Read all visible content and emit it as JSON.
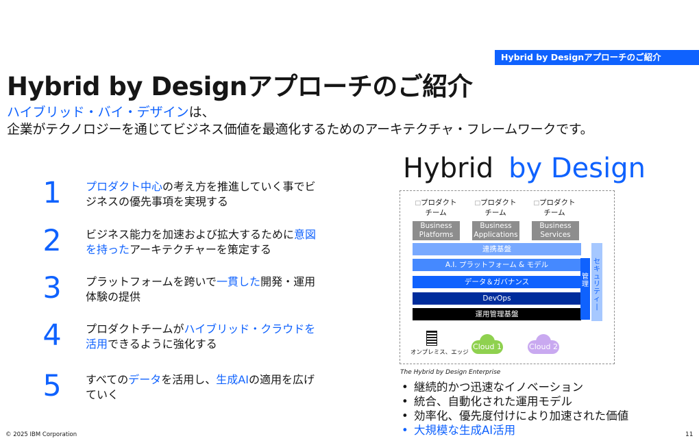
{
  "section_tag": "Hybrid by Designアプローチのご紹介",
  "title": "Hybrid by Designアプローチのご紹介",
  "subtitle": {
    "line1_highlight": "ハイブリッド・バイ・デザイン",
    "line1_rest": "は、",
    "line2": "企業がテクノロジーを通じてビジネス価値を最適化するためのアーキテクチャ・フレームワークです。"
  },
  "items": [
    {
      "number": "1",
      "parts": [
        {
          "text": "プロダクト中心",
          "hl": true
        },
        {
          "text": "の考え方を推進していく事でビジネスの優先事項を実現する",
          "hl": false
        }
      ]
    },
    {
      "number": "2",
      "parts": [
        {
          "text": "ビジネス能力を加速および拡大するために",
          "hl": false
        },
        {
          "text": "意図を持った",
          "hl": true
        },
        {
          "text": "アーキテクチャーを策定する",
          "hl": false
        }
      ]
    },
    {
      "number": "3",
      "parts": [
        {
          "text": "プラットフォームを跨いで",
          "hl": false
        },
        {
          "text": "一貫した",
          "hl": true
        },
        {
          "text": "開発・運用体験の提供",
          "hl": false
        }
      ]
    },
    {
      "number": "4",
      "parts": [
        {
          "text": "プロダクトチームが",
          "hl": false
        },
        {
          "text": "ハイブリッド・クラウドを活用",
          "hl": true
        },
        {
          "text": "できるように強化する",
          "hl": false
        }
      ]
    },
    {
      "number": "5",
      "parts": [
        {
          "text": "すべての",
          "hl": false
        },
        {
          "text": "データ",
          "hl": true
        },
        {
          "text": "を活用し、",
          "hl": false
        },
        {
          "text": "生成AI",
          "hl": true
        },
        {
          "text": "の適用を広げていく",
          "hl": false
        }
      ]
    }
  ],
  "diagram": {
    "heading_black": "Hybrid",
    "heading_blue": "by Design",
    "teams": [
      "プロダクト\nチーム",
      "プロダクト\nチーム",
      "プロダクト\nチーム"
    ],
    "platforms": [
      "Business\nPlatforms",
      "Business\nApplications",
      "Business\nServices"
    ],
    "layers": [
      {
        "label": "連携基盤",
        "color": "#78a9ff"
      },
      {
        "label": "A.I. プラットフォーム & モデル",
        "color": "#4589ff"
      },
      {
        "label": "データ＆ガバナンス",
        "color": "#0f62fe"
      },
      {
        "label": "DevOps",
        "color": "#002d9c"
      },
      {
        "label": "運用管理基盤",
        "color": "#000000"
      }
    ],
    "side_manage": "管理",
    "side_security": "セキュリティー",
    "onprem_label": "オンプレミス、エッジ",
    "clouds": [
      {
        "label": "Cloud 1",
        "color": "#8fd14f"
      },
      {
        "label": "Cloud 2",
        "color": "#c9a9f0"
      }
    ],
    "caption": "The Hybrid by Design Enterprise"
  },
  "bullets": [
    {
      "text": "継続的かつ迅速なイノベーション",
      "hl": false
    },
    {
      "text": "統合、自動化された運用モデル",
      "hl": false
    },
    {
      "text": "効率化、優先度付けにより加速された価値",
      "hl": false
    },
    {
      "text": "大規模な生成AI活用",
      "hl": true
    }
  ],
  "footer": "© 2025 IBM Corporation",
  "page_number": "11"
}
